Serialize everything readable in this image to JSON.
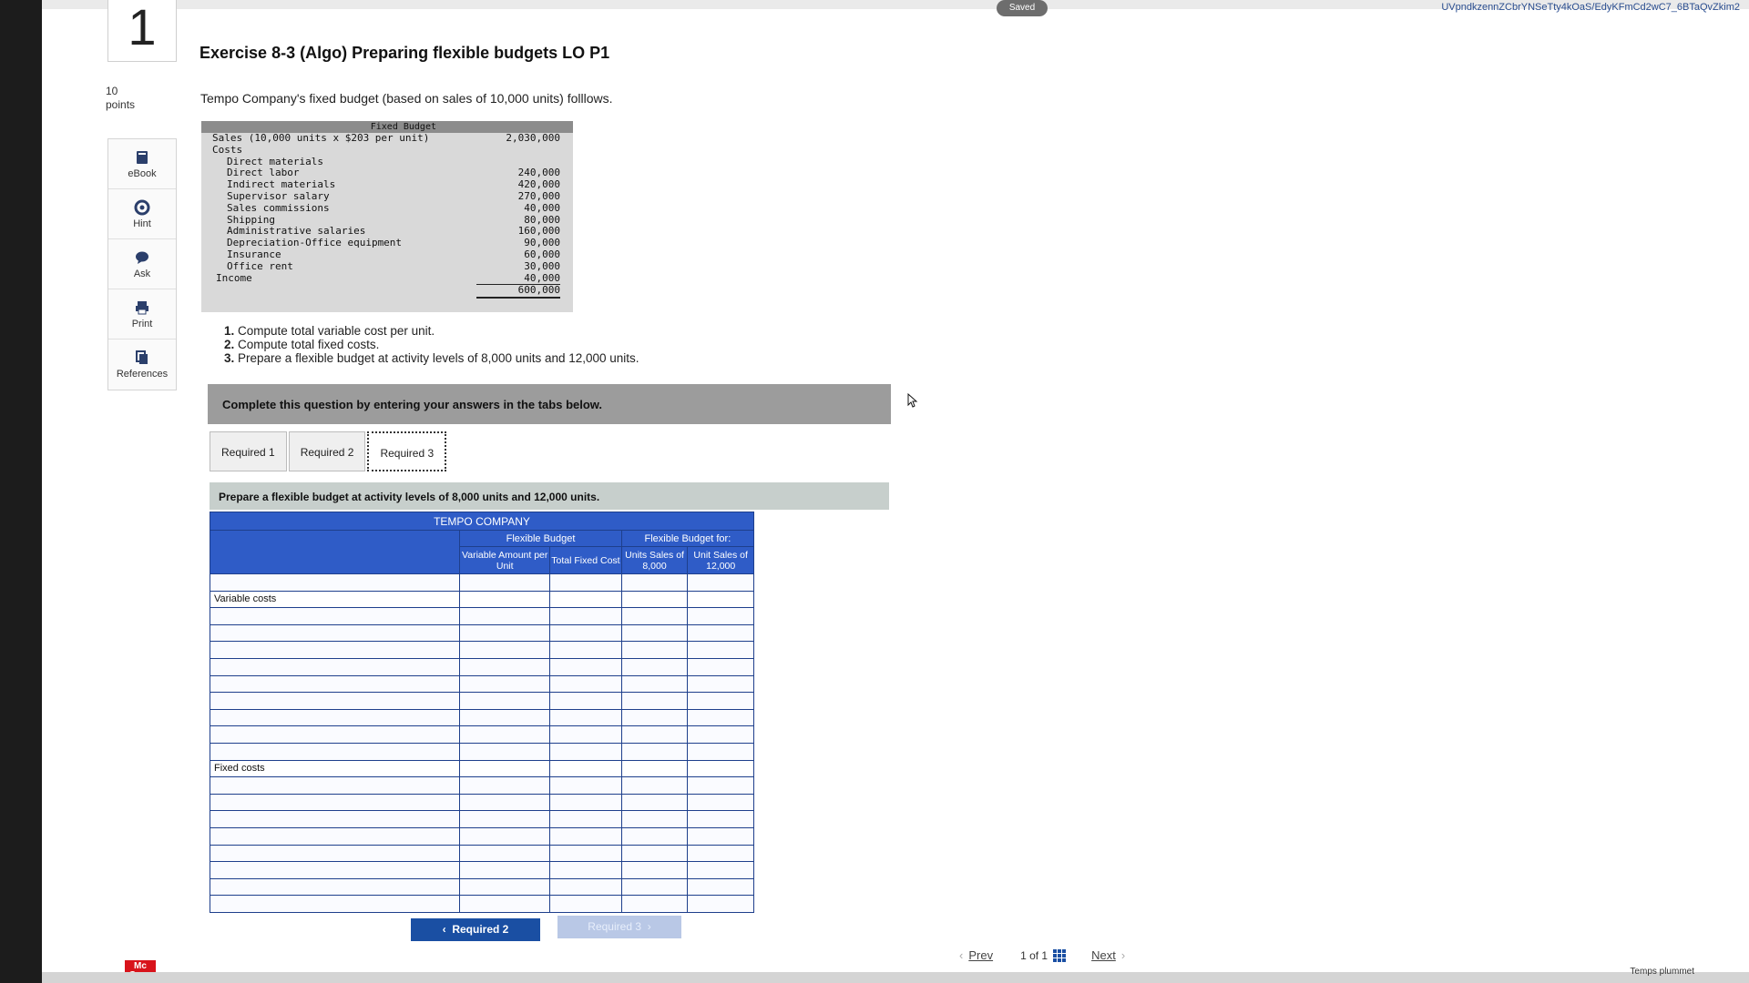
{
  "top": {
    "saved_label": "Saved",
    "url_fragment": "UVpndkzennZCbrYNSeTty4kOaS/EdyKFmCd2wC7_6BTaQvZkim2"
  },
  "question": {
    "number": "1",
    "points_value": "10",
    "points_label": "points",
    "title": "Exercise 8-3 (Algo) Preparing flexible budgets LO P1",
    "intro": "Tempo Company's fixed budget (based on sales of 10,000 units) folllows."
  },
  "tools": [
    {
      "label": "eBook",
      "icon": "book-icon"
    },
    {
      "label": "Hint",
      "icon": "lifebuoy-icon"
    },
    {
      "label": "Ask",
      "icon": "speech-bubble-icon"
    },
    {
      "label": "Print",
      "icon": "printer-icon"
    },
    {
      "label": "References",
      "icon": "copy-icon"
    }
  ],
  "fixed_budget": {
    "header": "Fixed Budget",
    "sales_label": "Sales (10,000 units x $203 per unit)",
    "sales_amount": "2,030,000",
    "costs_label": "Costs",
    "costs": [
      {
        "label": "Direct materials",
        "amount": ""
      },
      {
        "label": "Direct labor",
        "amount": "240,000"
      },
      {
        "label": "Indirect materials",
        "amount": "420,000"
      },
      {
        "label": "Supervisor salary",
        "amount": "270,000"
      },
      {
        "label": "Sales commissions",
        "amount": "40,000"
      },
      {
        "label": "Shipping",
        "amount": "80,000"
      },
      {
        "label": "Administrative salaries",
        "amount": "160,000"
      },
      {
        "label": "Depreciation-Office equipment",
        "amount": "90,000"
      },
      {
        "label": "Insurance",
        "amount": "60,000"
      },
      {
        "label": "Office rent",
        "amount": "30,000"
      },
      {
        "label": "",
        "amount": "40,000"
      }
    ],
    "income_label": "Income",
    "income_amount": "600,000"
  },
  "instructions": [
    {
      "num": "1.",
      "text": "Compute total variable cost per unit."
    },
    {
      "num": "2.",
      "text": "Compute total fixed costs."
    },
    {
      "num": "3.",
      "text": "Prepare a flexible budget at activity levels of 8,000 units and 12,000 units."
    }
  ],
  "panel": {
    "complete_text": "Complete this question by entering your answers in the tabs below.",
    "tabs": [
      "Required 1",
      "Required 2",
      "Required 3"
    ],
    "active_tab": "Required 3",
    "prepare_text": "Prepare a flexible budget at activity levels of 8,000 units and 12,000 units."
  },
  "flex_table": {
    "company": "TEMPO COMPANY",
    "group1": "Flexible Budget",
    "group2": "Flexible Budget for:",
    "col1": "Variable Amount per Unit",
    "col2": "Total Fixed Cost",
    "col3": "Units Sales of 8,000",
    "col4": "Unit Sales of 12,000",
    "variable_label": "Variable costs",
    "fixed_label": "Fixed costs"
  },
  "nav": {
    "prev_required": "Required 2",
    "next_required": "Required 3",
    "prev": "Prev",
    "page_of": "1 of 1",
    "next": "Next"
  },
  "brand": {
    "logo": "Mc Graw"
  },
  "tray": {
    "text": "Temps plummet"
  }
}
